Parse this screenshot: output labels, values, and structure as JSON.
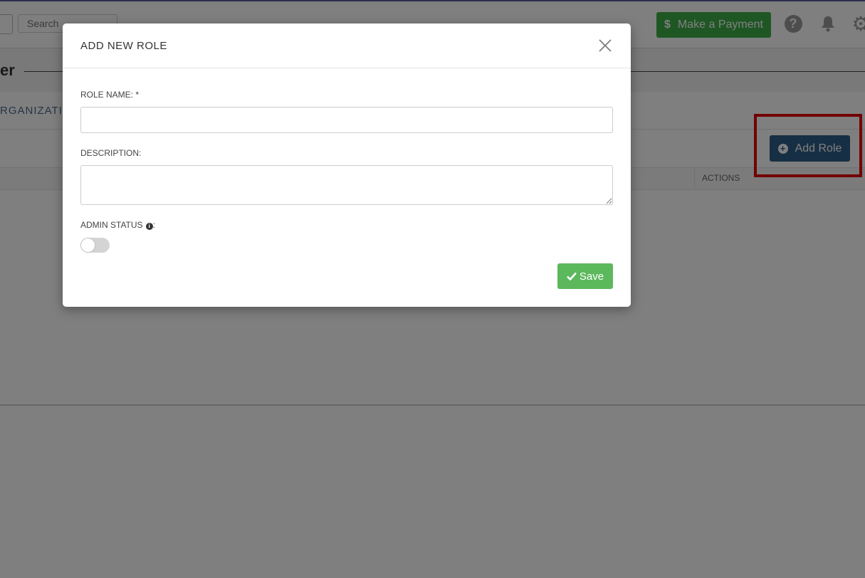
{
  "topbar": {
    "search_placeholder": "Search",
    "payment_button_icon": "$",
    "payment_button_label": "Make a Payment",
    "help_icon_glyph": "?"
  },
  "page": {
    "title": "er",
    "org_tab_label": "RGANIZATIO"
  },
  "toolbar": {
    "add_role_label": "Add Role"
  },
  "table": {
    "actions_header": "ACTIONS"
  },
  "modal": {
    "title": "ADD NEW ROLE",
    "role_name_label": "ROLE NAME: *",
    "role_name_value": "",
    "description_label": "DESCRIPTION:",
    "description_value": "",
    "admin_status_label": "ADMIN STATUS",
    "admin_status_suffix": ":",
    "admin_status_on": false,
    "save_label": "Save"
  },
  "colors": {
    "payment_green": "#3fae49",
    "add_role_blue": "#2f5f88",
    "save_green": "#5cb85c",
    "highlight_red": "#e60000"
  }
}
